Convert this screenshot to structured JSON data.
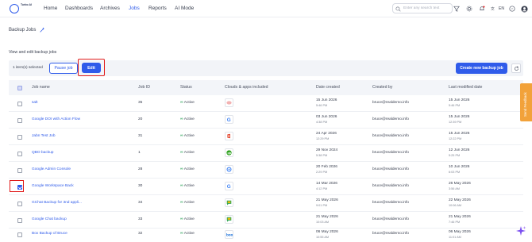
{
  "app": {
    "logo_text": "Turbo AI"
  },
  "nav": {
    "items": [
      {
        "label": "Home"
      },
      {
        "label": "Dashboards"
      },
      {
        "label": "Archives"
      },
      {
        "label": "Jobs"
      },
      {
        "label": "Reports"
      },
      {
        "label": "AI Mode"
      }
    ],
    "active": "Jobs"
  },
  "search": {
    "placeholder": "Enter any search text"
  },
  "lang": {
    "label": "EN"
  },
  "page": {
    "title": "Backup Jobs",
    "subtitle": "View and edit backup jobs"
  },
  "toolbar": {
    "selected_text": "1 item(s) selected",
    "pause_label": "Pause job",
    "edit_label": "Edit",
    "create_label": "Create new backup job"
  },
  "table": {
    "columns": [
      "Job name",
      "Job ID",
      "Status",
      "Clouds & apps included",
      "Date created",
      "Created by",
      "Last modified date"
    ],
    "rows": [
      {
        "name": "salt",
        "id": "35",
        "status": "Active",
        "app": "salesforce-icon",
        "created_date": "15 Jun 2026",
        "created_time": "5:46 PM",
        "created_by": "bruce@realdemo.info",
        "modified_date": "15 Jun 2026",
        "modified_time": "5:46 PM",
        "checked": false
      },
      {
        "name": "Google DOI with Action Flow",
        "id": "20",
        "status": "Active",
        "app": "google-icon",
        "created_date": "03 Jun 2026",
        "created_time": "4:38 PM",
        "created_by": "bruce@realdemo.info",
        "modified_date": "15 Jun 2026",
        "modified_time": "12:39 PM",
        "checked": false
      },
      {
        "name": "Jabn Test Job",
        "id": "31",
        "status": "Active",
        "app": "office-icon",
        "created_date": "24 Apr 2026",
        "created_time": "12:29 PM",
        "created_by": "bruce@realdemo.info",
        "modified_date": "15 Jun 2026",
        "modified_time": "12:22 PM",
        "checked": false
      },
      {
        "name": "QBO backup",
        "id": "1",
        "status": "Active",
        "app": "quickbooks-icon",
        "created_date": "29 Nov 2024",
        "created_time": "5:38 PM",
        "created_by": "bruce@realdemo.info",
        "modified_date": "12 Jun 2026",
        "modified_time": "5:25 PM",
        "checked": false
      },
      {
        "name": "Google Admin Console",
        "id": "28",
        "status": "Active",
        "app": "admin-console-icon",
        "created_date": "20 Feb 2026",
        "created_time": "2:29 PM",
        "created_by": "bruce@realdemo.info",
        "modified_date": "10 Jun 2026",
        "modified_time": "6:03 PM",
        "checked": false
      },
      {
        "name": "Google Workspace Back",
        "id": "30",
        "status": "Active",
        "app": "google-icon",
        "created_date": "14 Mar 2026",
        "created_time": "4:12 PM",
        "created_by": "bruce@realdemo.info",
        "modified_date": "26 May 2026",
        "modified_time": "3:56 AM",
        "checked": true
      },
      {
        "name": "GChat Backup for 3nd appli...",
        "id": "34",
        "status": "Active",
        "app": "google-chat-icon",
        "created_date": "21 May 2026",
        "created_time": "9:01 PM",
        "created_by": "bruce@realdemo.info",
        "modified_date": "22 May 2026",
        "modified_time": "10:06 AM",
        "checked": false
      },
      {
        "name": "Google Chat backup",
        "id": "33",
        "status": "Active",
        "app": "google-chat-icon",
        "created_date": "21 May 2026",
        "created_time": "10:03 AM",
        "created_by": "bruce@realdemo.info",
        "modified_date": "21 May 2026",
        "modified_time": "7:46 PM",
        "checked": false
      },
      {
        "name": "Box Backup of Bruce",
        "id": "32",
        "status": "Active",
        "app": "box-icon",
        "created_date": "06 May 2026",
        "created_time": "10:55 AM",
        "created_by": "bruce@realdemo.info",
        "modified_date": "06 May 2026",
        "modified_time": "11:01 AM",
        "checked": false
      }
    ]
  },
  "feedback": {
    "label": "Send Feedback"
  },
  "colors": {
    "accent": "#2f5bea",
    "highlight": "#e01b1b",
    "feedback": "#f2a23a",
    "active_status": "#2ea35a"
  }
}
